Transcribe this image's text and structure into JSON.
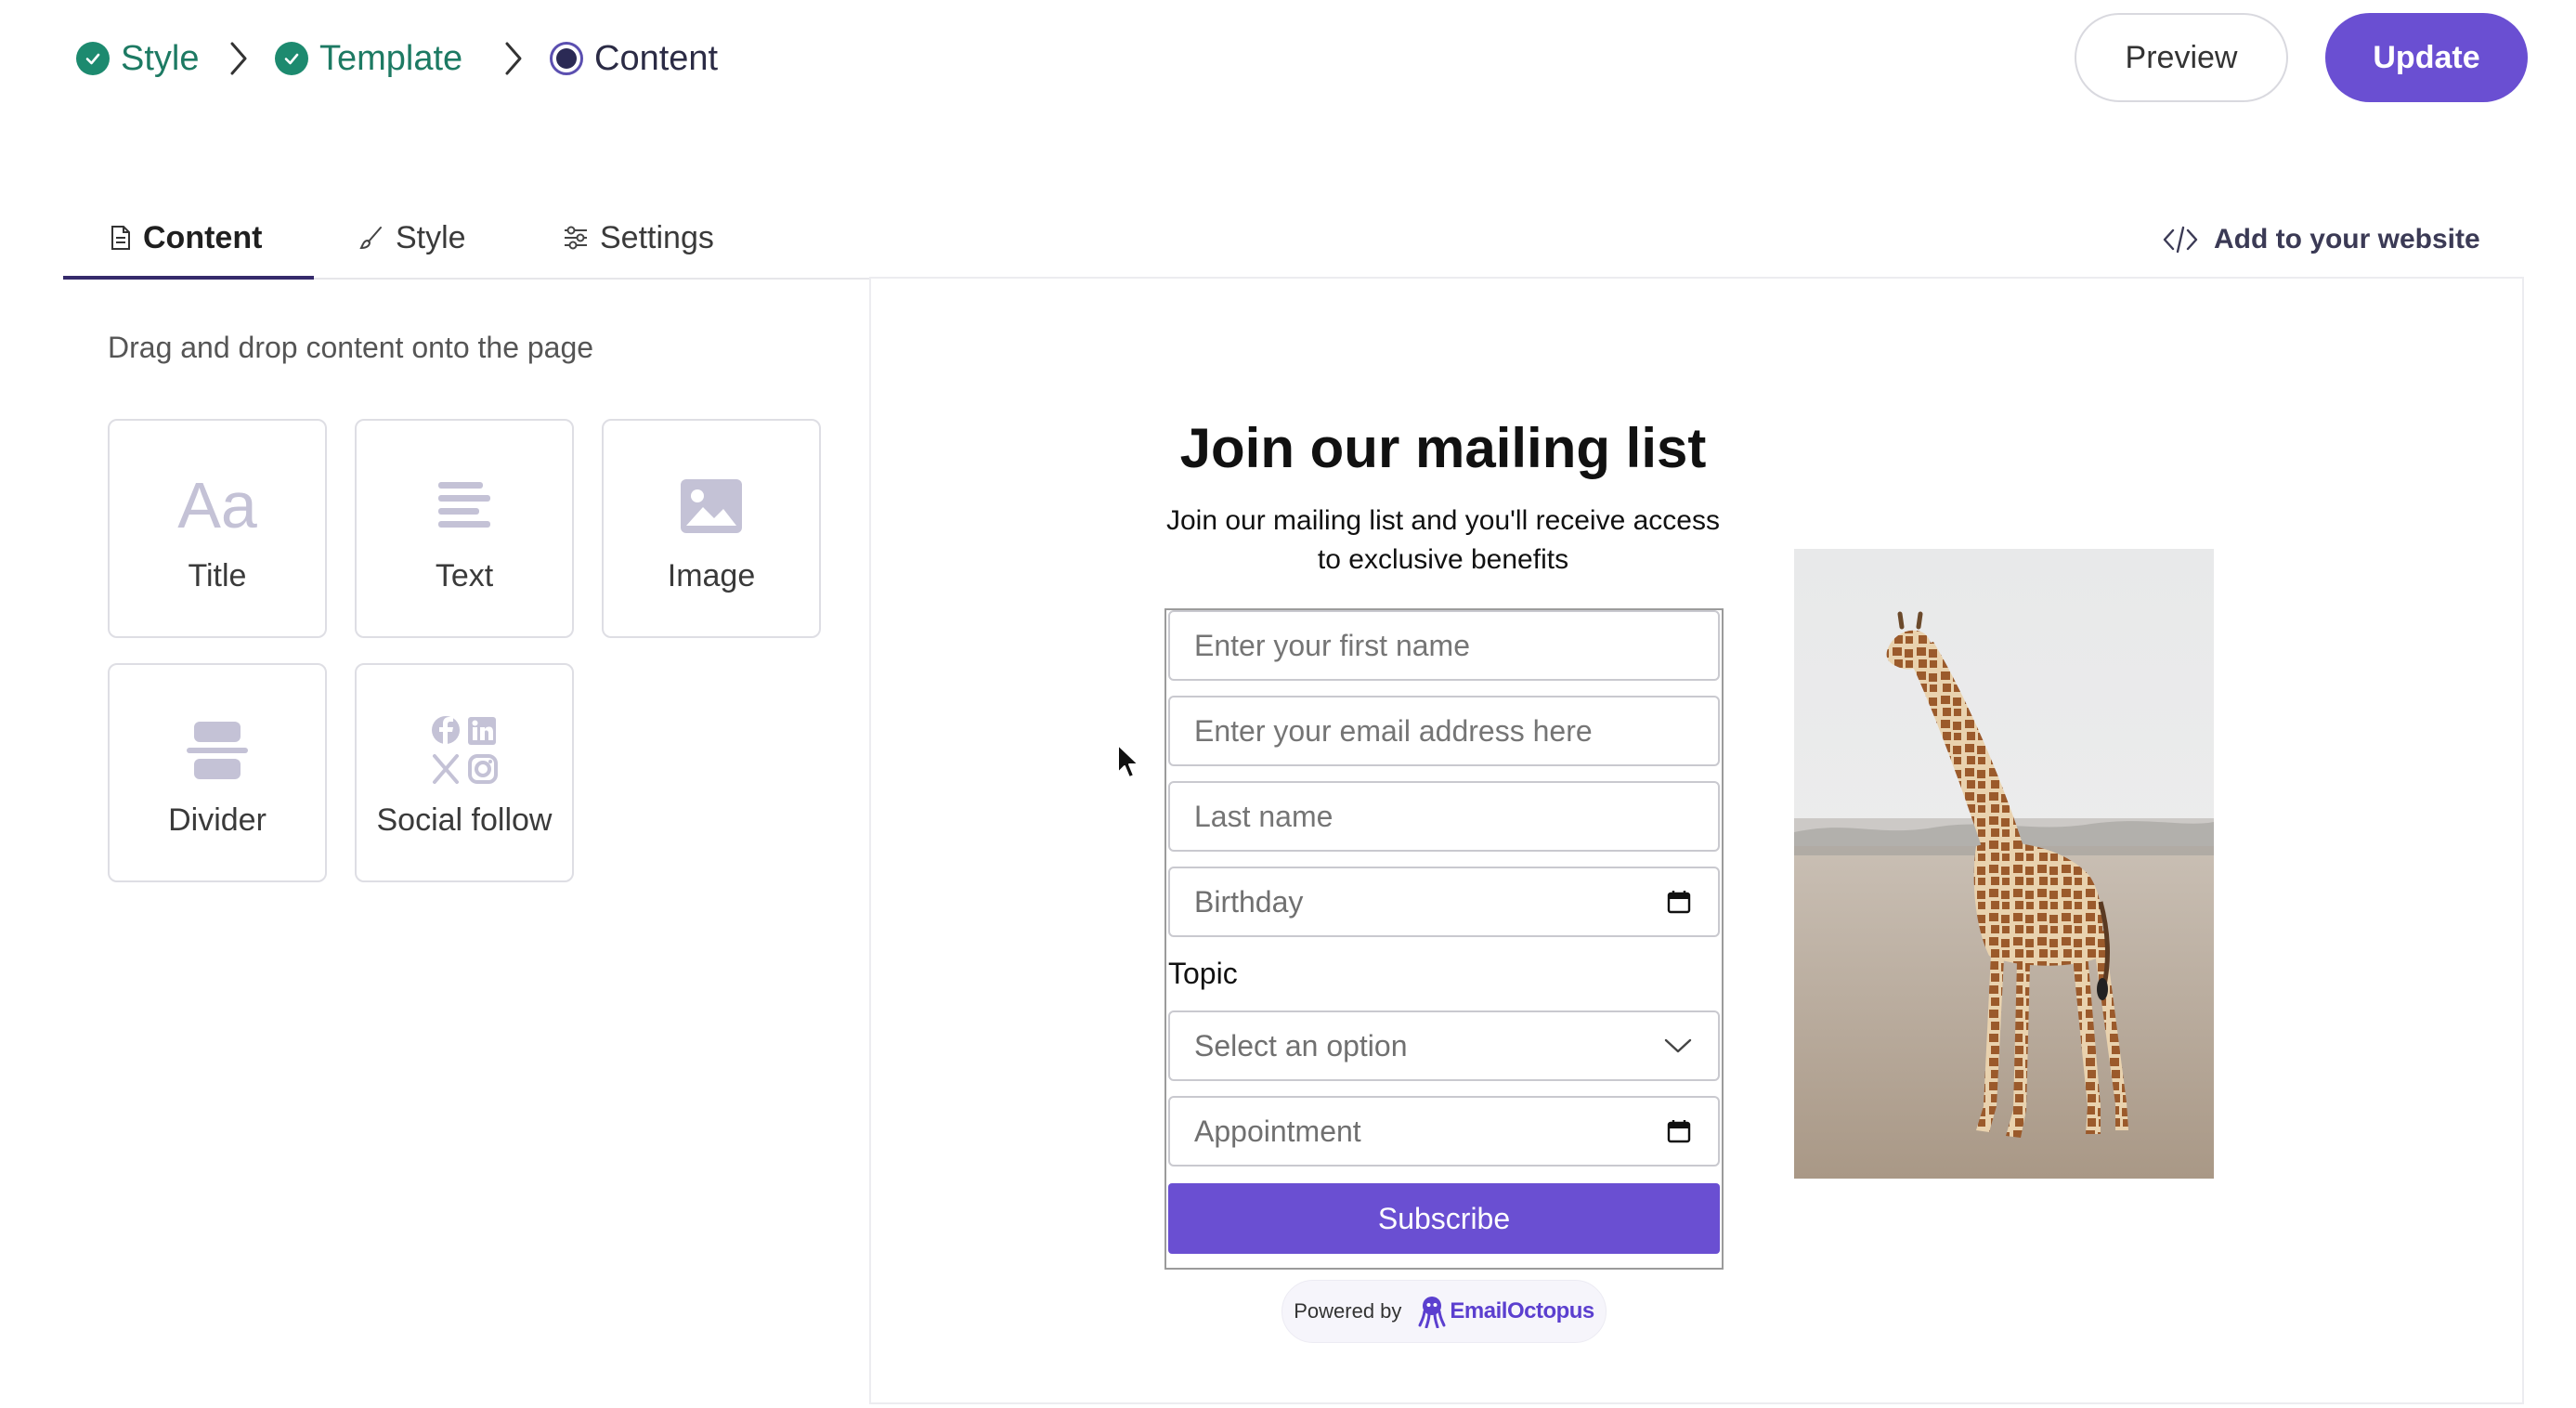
{
  "steps": [
    {
      "label": "Style",
      "status": "done"
    },
    {
      "label": "Template",
      "status": "done"
    },
    {
      "label": "Content",
      "status": "current"
    }
  ],
  "header": {
    "preview_label": "Preview",
    "update_label": "Update"
  },
  "tabs": [
    {
      "label": "Content",
      "icon": "document-icon",
      "active": true
    },
    {
      "label": "Style",
      "icon": "brush-icon",
      "active": false
    },
    {
      "label": "Settings",
      "icon": "sliders-icon",
      "active": false
    }
  ],
  "embed_link": {
    "label": "Add to your website",
    "icon": "code-icon"
  },
  "panel": {
    "hint": "Drag and drop content onto the page",
    "blocks": [
      {
        "label": "Title",
        "icon": "title-icon"
      },
      {
        "label": "Text",
        "icon": "text-lines-icon"
      },
      {
        "label": "Image",
        "icon": "image-icon"
      },
      {
        "label": "Divider",
        "icon": "divider-icon"
      },
      {
        "label": "Social follow",
        "icon": "social-icons"
      }
    ]
  },
  "form": {
    "title": "Join our mailing list",
    "subtitle": "Join our mailing list and you'll receive access to exclusive benefits",
    "fields": {
      "first_name": "Enter your first name",
      "email": "Enter your email address here",
      "last_name": "Last name",
      "birthday": "Birthday",
      "topic_label": "Topic",
      "topic_select": "Select an option",
      "appointment": "Appointment"
    },
    "subscribe_label": "Subscribe",
    "powered_by": "Powered by",
    "brand": "EmailOctopus"
  },
  "colors": {
    "accent": "#6a4fd2",
    "step_done": "#1d8a6f",
    "tab_underline": "#352a6b"
  }
}
